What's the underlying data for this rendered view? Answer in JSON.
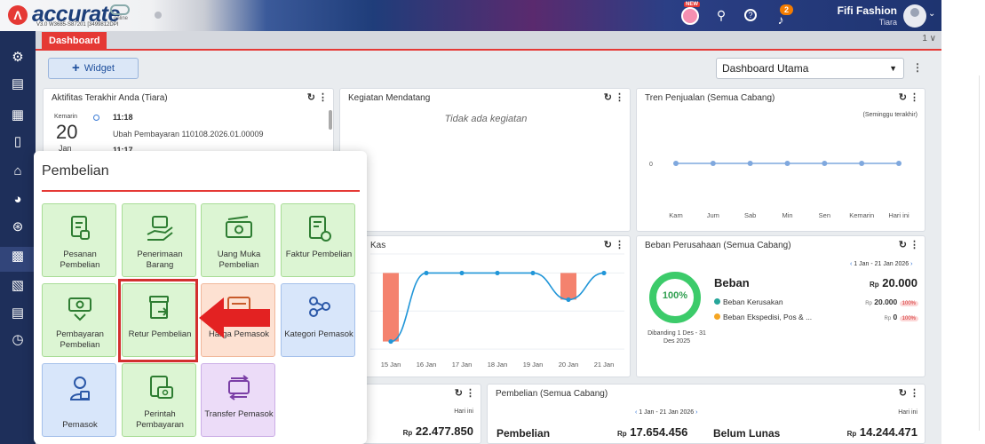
{
  "app": {
    "brand": "accurate",
    "brand_sub": "online",
    "version": "V3.0 W3685-S87201 [3499812DPI",
    "new_badge": "NEW",
    "notif_count": "2",
    "user_name": "Fifi Fashion",
    "user_role": "Tiara",
    "accent": "#e53935",
    "nav_color": "#1e2f5a"
  },
  "icons": {
    "sidebar": [
      "gear-icon",
      "inbox-icon",
      "building-icon",
      "phone-icon",
      "bank-icon",
      "money-bag-icon",
      "cart-icon",
      "truck-icon",
      "ledger-icon",
      "report-icon",
      "gauge-icon"
    ],
    "topbar": [
      "mascot-icon",
      "search-icon",
      "help-icon",
      "bell-icon",
      "avatar-icon"
    ]
  },
  "tabs": {
    "active": "Dashboard",
    "count": "1 ∨"
  },
  "toolbar": {
    "widget_label": "Widget",
    "dashboard_select": "Dashboard Utama"
  },
  "activity": {
    "title": "Aktifitas Terakhir Anda (Tiara)",
    "day_word": "Kemarin",
    "day_num": "20",
    "month": "Jan",
    "time1": "11:18",
    "desc1": "Ubah Pembayaran 110108.2026.01.00009",
    "time2": "11:17"
  },
  "events": {
    "title": "Kegiatan Mendatang",
    "empty": "Tidak ada kegiatan"
  },
  "sales_trend": {
    "title": "Tren Penjualan (Semua Cabang)",
    "period": "(Seminggu terakhir)"
  },
  "kas": {
    "title": "Kas"
  },
  "expense": {
    "title": "Beban Perusahaan (Semua Cabang)",
    "range": "1 Jan - 21 Jan 2026",
    "percent": "100%",
    "compare": "Dibanding 1 Des - 31 Des 2025",
    "heading": "Beban",
    "currency": "Rp",
    "total": "20.000",
    "items": [
      {
        "name": "Beban Kerusakan",
        "value": "20.000",
        "pct": "100%",
        "color": "#26a69a"
      },
      {
        "name": "Beban Ekspedisi, Pos & ...",
        "value": "0",
        "pct": "100%",
        "color": "#f5a623"
      }
    ]
  },
  "bottom_left": {
    "label": "Hari ini",
    "currency": "Rp",
    "value": "22.477.850"
  },
  "purchases": {
    "title": "Pembelian (Semua Cabang)",
    "range": "1 Jan - 21 Jan 2026",
    "today": "Hari ini",
    "label1": "Pembelian",
    "currency": "Rp",
    "value1": "17.654.456",
    "label2": "Belum Lunas",
    "value2": "14.244.471"
  },
  "popup": {
    "title": "Pembelian",
    "tiles": [
      {
        "label": "Pesanan Pembelian",
        "icon": "purchase-order-icon",
        "color": "green"
      },
      {
        "label": "Penerimaan Barang",
        "icon": "goods-receipt-icon",
        "color": "green"
      },
      {
        "label": "Uang Muka Pembelian",
        "icon": "cash-advance-icon",
        "color": "green"
      },
      {
        "label": "Faktur Pembelian",
        "icon": "invoice-icon",
        "color": "green"
      },
      {
        "label": "Pembayaran Pembelian",
        "icon": "payment-icon",
        "color": "green"
      },
      {
        "label": "Retur Pembelian",
        "icon": "return-icon",
        "color": "green"
      },
      {
        "label": "Harga Pemasok",
        "icon": "supplier-price-icon",
        "color": "orange"
      },
      {
        "label": "Kategori Pemasok",
        "icon": "supplier-category-icon",
        "color": "blue"
      },
      {
        "label": "Pemasok",
        "icon": "supplier-icon",
        "color": "blue"
      },
      {
        "label": "Perintah Pembayaran",
        "icon": "payment-order-icon",
        "color": "green"
      },
      {
        "label": "Transfer Pemasok",
        "icon": "transfer-icon",
        "color": "purple"
      }
    ]
  },
  "chart_data": [
    {
      "type": "line",
      "title": "Tren Penjualan (Semua Cabang)",
      "categories": [
        "Kam",
        "Jum",
        "Sab",
        "Min",
        "Sen",
        "Kemarin",
        "Hari ini"
      ],
      "series": [
        {
          "values": [
            0,
            0,
            0,
            0,
            0,
            0,
            0
          ]
        }
      ],
      "ytick": "0",
      "color": "#7fa8de"
    },
    {
      "type": "bar",
      "title": "Kas",
      "categories": [
        "15 Jan",
        "16 Jan",
        "17 Jan",
        "18 Jan",
        "19 Jan",
        "20 Jan",
        "21 Jan"
      ],
      "line_values": [
        -0.9,
        0,
        0,
        0,
        0,
        -0.35,
        0
      ],
      "bars": [
        {
          "category": "15 Jan",
          "low": -0.9,
          "high": 0
        },
        {
          "category": "20 Jan",
          "low": -0.35,
          "high": 0
        }
      ],
      "ylim": [
        -1.15,
        0.25
      ],
      "bar_color": "#f4826e",
      "line_color": "#2196d8"
    }
  ]
}
